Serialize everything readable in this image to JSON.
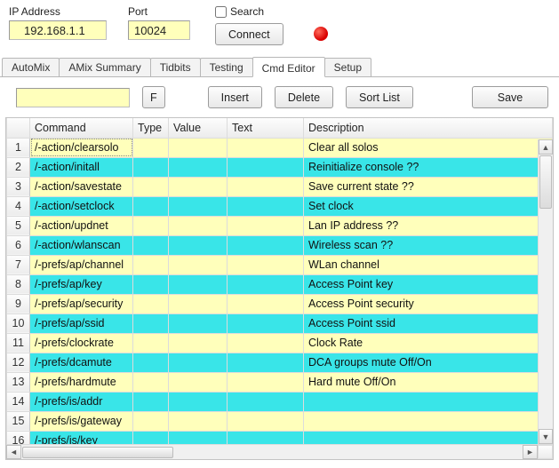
{
  "top": {
    "ip_label": "IP Address",
    "ip_value": "192.168.1.1",
    "port_label": "Port",
    "port_value": "10024",
    "search_label": "Search",
    "search_checked": false,
    "connect_label": "Connect"
  },
  "tabs": [
    {
      "label": "AutoMix",
      "active": false
    },
    {
      "label": "AMix Summary",
      "active": false
    },
    {
      "label": "Tidbits",
      "active": false
    },
    {
      "label": "Testing",
      "active": false
    },
    {
      "label": "Cmd Editor",
      "active": true
    },
    {
      "label": "Setup",
      "active": false
    }
  ],
  "toolbar": {
    "filter_value": "",
    "f_label": "F",
    "insert_label": "Insert",
    "delete_label": "Delete",
    "sort_label": "Sort List",
    "save_label": "Save"
  },
  "grid": {
    "headers": {
      "rownum": "",
      "command": "Command",
      "type": "Type",
      "value": "Value",
      "text": "Text",
      "description": "Description"
    },
    "rows": [
      {
        "n": 1,
        "command": "/-action/clearsolo",
        "type": "",
        "value": "",
        "text": "",
        "description": "Clear all solos",
        "cls": "row-yellow"
      },
      {
        "n": 2,
        "command": "/-action/initall",
        "type": "",
        "value": "",
        "text": "",
        "description": "Reinitialize console ??",
        "cls": "row-cyan"
      },
      {
        "n": 3,
        "command": "/-action/savestate",
        "type": "",
        "value": "",
        "text": "",
        "description": "Save current state ??",
        "cls": "row-yellow"
      },
      {
        "n": 4,
        "command": "/-action/setclock",
        "type": "",
        "value": "",
        "text": "",
        "description": "Set clock",
        "cls": "row-cyan"
      },
      {
        "n": 5,
        "command": "/-action/updnet",
        "type": "",
        "value": "",
        "text": "",
        "description": "Lan IP address ??",
        "cls": "row-yellow"
      },
      {
        "n": 6,
        "command": "/-action/wlanscan",
        "type": "",
        "value": "",
        "text": "",
        "description": "Wireless scan ??",
        "cls": "row-cyan"
      },
      {
        "n": 7,
        "command": "/-prefs/ap/channel",
        "type": "",
        "value": "",
        "text": "",
        "description": "WLan channel",
        "cls": "row-yellow"
      },
      {
        "n": 8,
        "command": "/-prefs/ap/key",
        "type": "",
        "value": "",
        "text": "",
        "description": "Access Point key",
        "cls": "row-cyan"
      },
      {
        "n": 9,
        "command": "/-prefs/ap/security",
        "type": "",
        "value": "",
        "text": "",
        "description": "Access Point security",
        "cls": "row-yellow"
      },
      {
        "n": 10,
        "command": "/-prefs/ap/ssid",
        "type": "",
        "value": "",
        "text": "",
        "description": "Access Point ssid",
        "cls": "row-cyan"
      },
      {
        "n": 11,
        "command": "/-prefs/clockrate",
        "type": "",
        "value": "",
        "text": "",
        "description": "Clock Rate",
        "cls": "row-yellow"
      },
      {
        "n": 12,
        "command": "/-prefs/dcamute",
        "type": "",
        "value": "",
        "text": "",
        "description": "DCA groups mute Off/On",
        "cls": "row-cyan"
      },
      {
        "n": 13,
        "command": "/-prefs/hardmute",
        "type": "",
        "value": "",
        "text": "",
        "description": "Hard mute Off/On",
        "cls": "row-yellow"
      },
      {
        "n": 14,
        "command": "/-prefs/is/addr",
        "type": "",
        "value": "",
        "text": "",
        "description": "",
        "cls": "row-cyan"
      },
      {
        "n": 15,
        "command": "/-prefs/is/gateway",
        "type": "",
        "value": "",
        "text": "",
        "description": "",
        "cls": "row-yellow"
      },
      {
        "n": 16,
        "command": "/-prefs/is/key",
        "type": "",
        "value": "",
        "text": "",
        "description": "",
        "cls": "row-cyan"
      }
    ]
  }
}
